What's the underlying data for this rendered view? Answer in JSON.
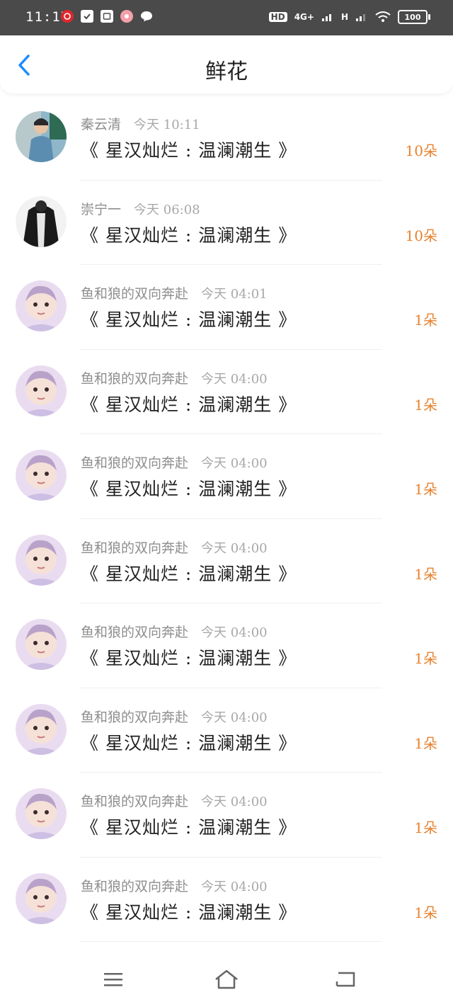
{
  "status_bar": {
    "time": "11:17",
    "network_hd": "HD",
    "network_4g": "4G+",
    "network_h": "H",
    "battery": "100"
  },
  "header": {
    "title": "鲜花",
    "back_icon": "chevron-left-icon"
  },
  "colors": {
    "accent": "#1a8cff",
    "count": "#e8822e",
    "meta": "#8e8e8e"
  },
  "rows": [
    {
      "user": "秦云清",
      "time": "今天 10:11",
      "book": "《 星汉灿烂 : 温澜潮生 》",
      "count": "10朵",
      "avatar": "photo-boy"
    },
    {
      "user": "崇宁一",
      "time": "今天 06:08",
      "book": "《 星汉灿烂 : 温澜潮生 》",
      "count": "10朵",
      "avatar": "photo-dark"
    },
    {
      "user": "鱼和狼的双向奔赴",
      "time": "今天 04:01",
      "book": "《 星汉灿烂 : 温澜潮生 》",
      "count": "1朵",
      "avatar": "photo-baby"
    },
    {
      "user": "鱼和狼的双向奔赴",
      "time": "今天 04:00",
      "book": "《 星汉灿烂 : 温澜潮生 》",
      "count": "1朵",
      "avatar": "photo-baby"
    },
    {
      "user": "鱼和狼的双向奔赴",
      "time": "今天 04:00",
      "book": "《 星汉灿烂 : 温澜潮生 》",
      "count": "1朵",
      "avatar": "photo-baby"
    },
    {
      "user": "鱼和狼的双向奔赴",
      "time": "今天 04:00",
      "book": "《 星汉灿烂 : 温澜潮生 》",
      "count": "1朵",
      "avatar": "photo-baby"
    },
    {
      "user": "鱼和狼的双向奔赴",
      "time": "今天 04:00",
      "book": "《 星汉灿烂 : 温澜潮生 》",
      "count": "1朵",
      "avatar": "photo-baby"
    },
    {
      "user": "鱼和狼的双向奔赴",
      "time": "今天 04:00",
      "book": "《 星汉灿烂 : 温澜潮生 》",
      "count": "1朵",
      "avatar": "photo-baby"
    },
    {
      "user": "鱼和狼的双向奔赴",
      "time": "今天 04:00",
      "book": "《 星汉灿烂 : 温澜潮生 》",
      "count": "1朵",
      "avatar": "photo-baby"
    },
    {
      "user": "鱼和狼的双向奔赴",
      "time": "今天 04:00",
      "book": "《 星汉灿烂 : 温澜潮生 》",
      "count": "1朵",
      "avatar": "photo-baby"
    }
  ],
  "nav": {
    "menu_icon": "menu-icon",
    "home_icon": "home-icon",
    "back_icon": "back-icon"
  }
}
